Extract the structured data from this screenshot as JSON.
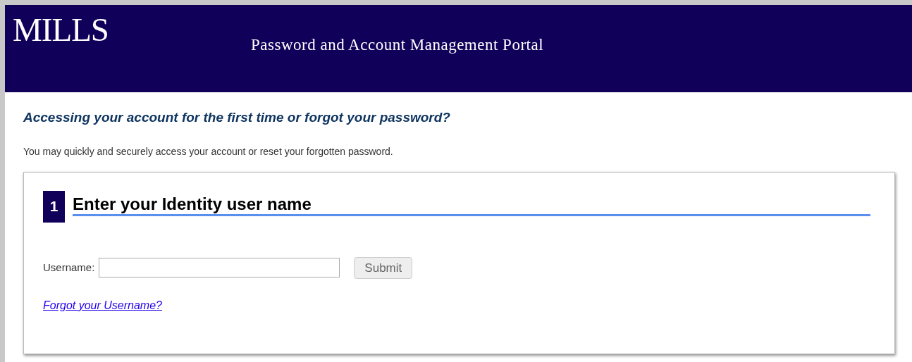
{
  "header": {
    "logo": "MILLS",
    "title": "Password and Account Management Portal"
  },
  "intro": {
    "heading": "Accessing your account for the first time or forgot your password?",
    "text": "You may quickly and securely access your account or reset your forgotten password."
  },
  "step": {
    "number": "1",
    "title": "Enter your Identity user name",
    "field_label": "Username:",
    "submit": {
      "label": "Submit",
      "disabled": true
    },
    "link": "Forgot your Username?"
  }
}
